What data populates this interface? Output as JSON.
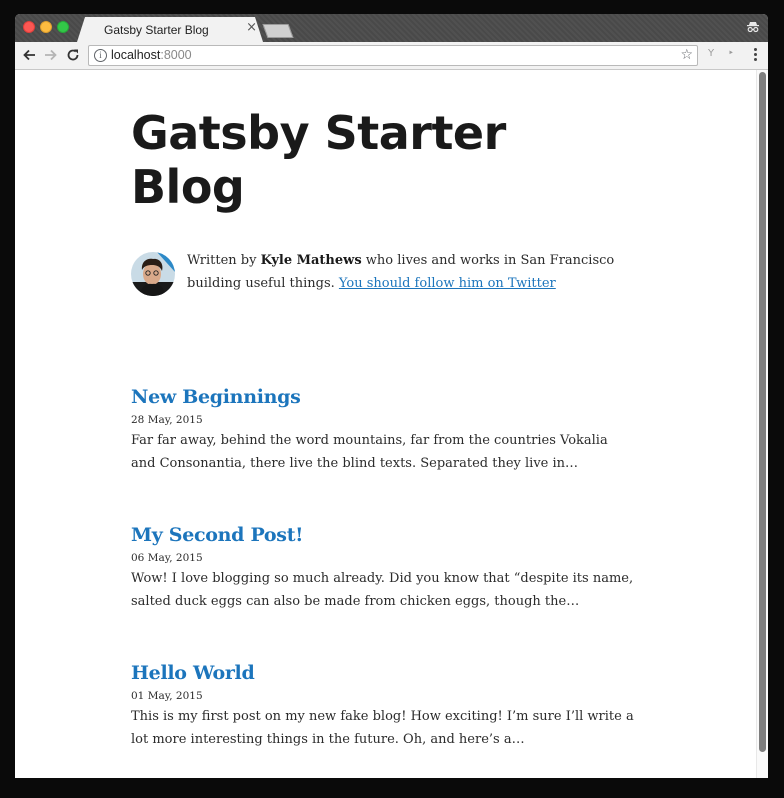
{
  "browser": {
    "tab_title": "Gatsby Starter Blog",
    "tab_close": "×",
    "url_host": "localhost",
    "url_port": ":8000",
    "info_icon": "i",
    "star_icon": "☆",
    "ext_icons": [
      "Y",
      "‣"
    ]
  },
  "page": {
    "site_title": "Gatsby Starter Blog",
    "bio": {
      "prefix": "Written by ",
      "author": "Kyle Mathews",
      "middle": " who lives and works in San Francisco building useful things. ",
      "link_text": "You should follow him on Twitter"
    },
    "posts": [
      {
        "title": "New Beginnings",
        "date": "28 May, 2015",
        "excerpt": "Far far away, behind the word mountains, far from the countries Vokalia and Consonantia, there live the blind texts. Separated they live in…"
      },
      {
        "title": "My Second Post!",
        "date": "06 May, 2015",
        "excerpt": "Wow! I love blogging so much already. Did you know that “despite its name, salted duck eggs can also be made from chicken eggs, though the…"
      },
      {
        "title": "Hello World",
        "date": "01 May, 2015",
        "excerpt": "This is my first post on my new fake blog! How exciting! I’m sure I’ll write a lot more interesting things in the future. Oh, and here’s a…"
      }
    ]
  },
  "colors": {
    "link": "#1c75bc",
    "text": "#2b2b2b",
    "title": "#1a1a1a"
  },
  "icons": {
    "back": "arrow-left-icon",
    "forward": "arrow-right-icon",
    "reload": "reload-icon",
    "info": "info-icon",
    "bookmark": "star-icon",
    "menu": "kebab-menu-icon",
    "incognito": "incognito-icon"
  }
}
